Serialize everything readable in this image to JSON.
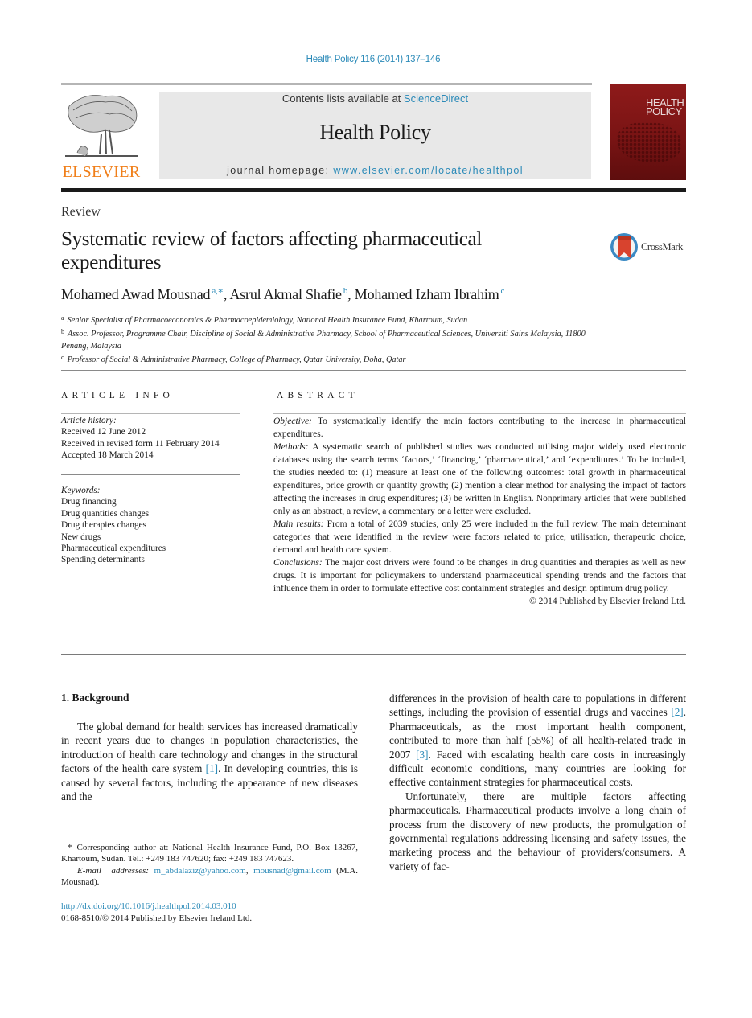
{
  "header": {
    "journal_ref": "Health Policy 116 (2014) 137–146",
    "contents_prefix": "Contents lists available at ",
    "contents_link": "ScienceDirect",
    "journal_title": "Health Policy",
    "homepage_prefix": "journal homepage: ",
    "homepage_link": "www.elsevier.com/locate/healthpol",
    "publisher_logo_text": "ELSEVIER",
    "cover_title_line1": "HEALTH",
    "cover_title_line2": "POLICY",
    "brand_color": "#f07f1a",
    "link_color": "#2b8ab8",
    "cover_color": "#8e1a1a"
  },
  "article": {
    "type": "Review",
    "title": "Systematic review of factors affecting pharmaceutical expenditures",
    "crossmark_label": "CrossMark",
    "authors": [
      {
        "name": "Mohamed Awad Mousnad",
        "sup": "a,∗"
      },
      {
        "name": "Asrul Akmal Shafie",
        "sup": "b"
      },
      {
        "name": "Mohamed Izham Ibrahim",
        "sup": "c"
      }
    ],
    "affiliations": [
      {
        "mark": "a",
        "text": "Senior Specialist of Pharmacoeconomics & Pharmacoepidemiology, National Health Insurance Fund, Khartoum, Sudan"
      },
      {
        "mark": "b",
        "text": "Assoc. Professor, Programme Chair, Discipline of Social & Administrative Pharmacy, School of Pharmaceutical Sciences, Universiti Sains Malaysia, 11800 Penang, Malaysia"
      },
      {
        "mark": "c",
        "text": "Professor of Social & Administrative Pharmacy, College of Pharmacy, Qatar University, Doha, Qatar"
      }
    ]
  },
  "article_info": {
    "heading": "ARTICLE INFO",
    "history_label": "Article history:",
    "history": [
      "Received 12 June 2012",
      "Received in revised form 11 February 2014",
      "Accepted 18 March 2014"
    ],
    "keywords_label": "Keywords:",
    "keywords": [
      "Drug financing",
      "Drug quantities changes",
      "Drug therapies changes",
      "New drugs",
      "Pharmaceutical expenditures",
      "Spending determinants"
    ]
  },
  "abstract": {
    "heading": "ABSTRACT",
    "sections": [
      {
        "label": "Objective:",
        "text": " To systematically identify the main factors contributing to the increase in pharmaceutical expenditures."
      },
      {
        "label": "Methods:",
        "text": " A systematic search of published studies was conducted utilising major widely used electronic databases using the search terms ‘factors,’ ‘financing,’ ‘pharmaceutical,’ and ‘expenditures.’ To be included, the studies needed to: (1) measure at least one of the following outcomes: total growth in pharmaceutical expenditures, price growth or quantity growth; (2) mention a clear method for analysing the impact of factors affecting the increases in drug expenditures; (3) be written in English. Nonprimary articles that were published only as an abstract, a review, a commentary or a letter were excluded."
      },
      {
        "label": "Main results:",
        "text": " From a total of 2039 studies, only 25 were included in the full review. The main determinant categories that were identified in the review were factors related to price, utilisation, therapeutic choice, demand and health care system."
      },
      {
        "label": "Conclusions:",
        "text": " The major cost drivers were found to be changes in drug quantities and therapies as well as new drugs. It is important for policymakers to understand pharmaceutical spending trends and the factors that influence them in order to formulate effective cost containment strategies and design optimum drug policy."
      }
    ],
    "copyright": "© 2014 Published by Elsevier Ireland Ltd."
  },
  "body": {
    "section_heading": "1.  Background",
    "left_para": {
      "part1": "The global demand for health services has increased dramatically in recent years due to changes in population characteristics, the introduction of health care technology and changes in the structural factors of the health care system ",
      "ref1": "[1]",
      "part2": ". In developing countries, this is caused by several factors, including the appearance of new diseases and the"
    },
    "right_para1": {
      "part1": "differences in the provision of health care to populations in different settings, including the provision of essential drugs and vaccines ",
      "ref2": "[2]",
      "part2": ". Pharmaceuticals, as the most important health component, contributed to more than half (55%) of all health-related trade in 2007 ",
      "ref3": "[3]",
      "part3": ". Faced with escalating health care costs in increasingly difficult economic conditions, many countries are looking for effective containment strategies for pharmaceutical costs."
    },
    "right_para2": "Unfortunately, there are multiple factors affecting pharmaceuticals. Pharmaceutical products involve a long chain of process from the discovery of new products, the promulgation of governmental regulations addressing licensing and safety issues, the marketing process and the behaviour of providers/consumers. A variety of fac-"
  },
  "footnote": {
    "star": "*",
    "corresponding": "Corresponding author at: National Health Insurance Fund, P.O. Box 13267, Khartoum, Sudan. Tel.: +249 183 747620; fax: +249 183 747623.",
    "email_label": "E-mail addresses:",
    "email1": "m_abdalaziz@yahoo.com",
    "email_sep": ", ",
    "email2": "mousnad@gmail.com",
    "email_owner": " (M.A. Mousnad).",
    "doi": "http://dx.doi.org/10.1016/j.healthpol.2014.03.010",
    "issn_line": "0168-8510/© 2014 Published by Elsevier Ireland Ltd."
  }
}
